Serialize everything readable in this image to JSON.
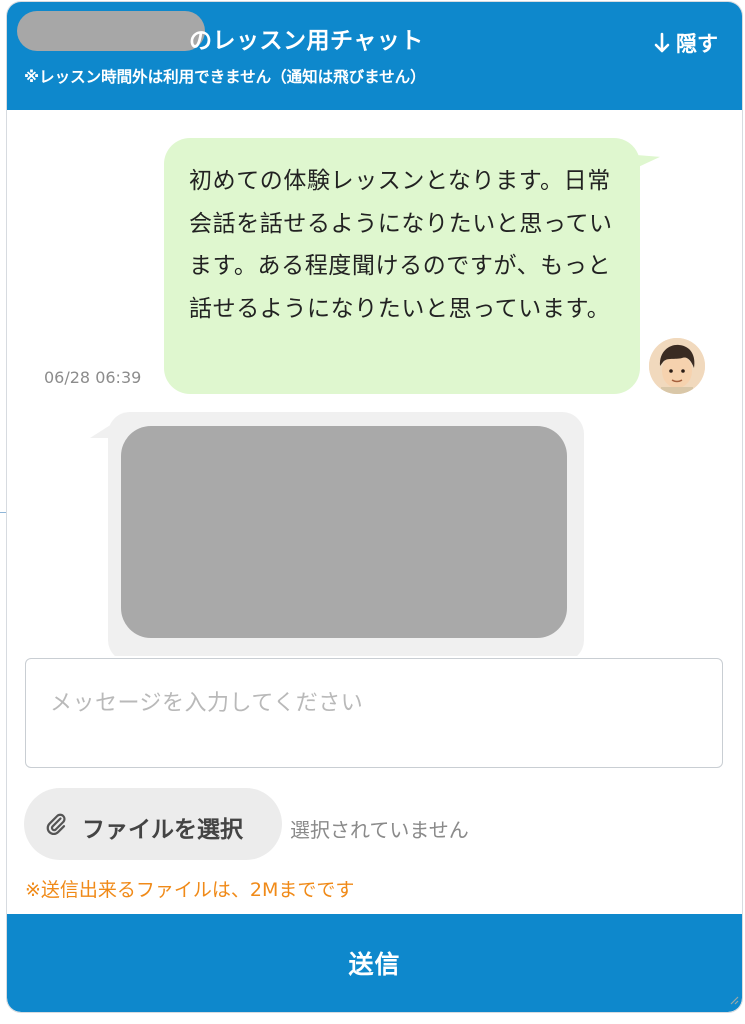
{
  "header": {
    "title": "のレッスン用チャット",
    "subtitle": "※レッスン時間外は利用できません（通知は飛びません）",
    "hide_label": "隠す"
  },
  "messages": [
    {
      "sender": "me",
      "text": "初めての体験レッスンとなります。日常会話を話せるようになりたいと思っています。ある程度聞けるのですが、もっと話せるようになりたいと思っています。",
      "time": "06/28 06:39"
    }
  ],
  "composer": {
    "placeholder": "メッセージを入力してください",
    "file_button_label": "ファイルを選択",
    "file_status": "選択されていません",
    "file_note": "※送信出来るファイルは、2Mまでです",
    "send_label": "送信"
  },
  "colors": {
    "header_bg": "#0e88cc",
    "my_bubble": "#dff7cf",
    "other_bubble": "#f0f0f0",
    "note_orange": "#f08a18"
  }
}
